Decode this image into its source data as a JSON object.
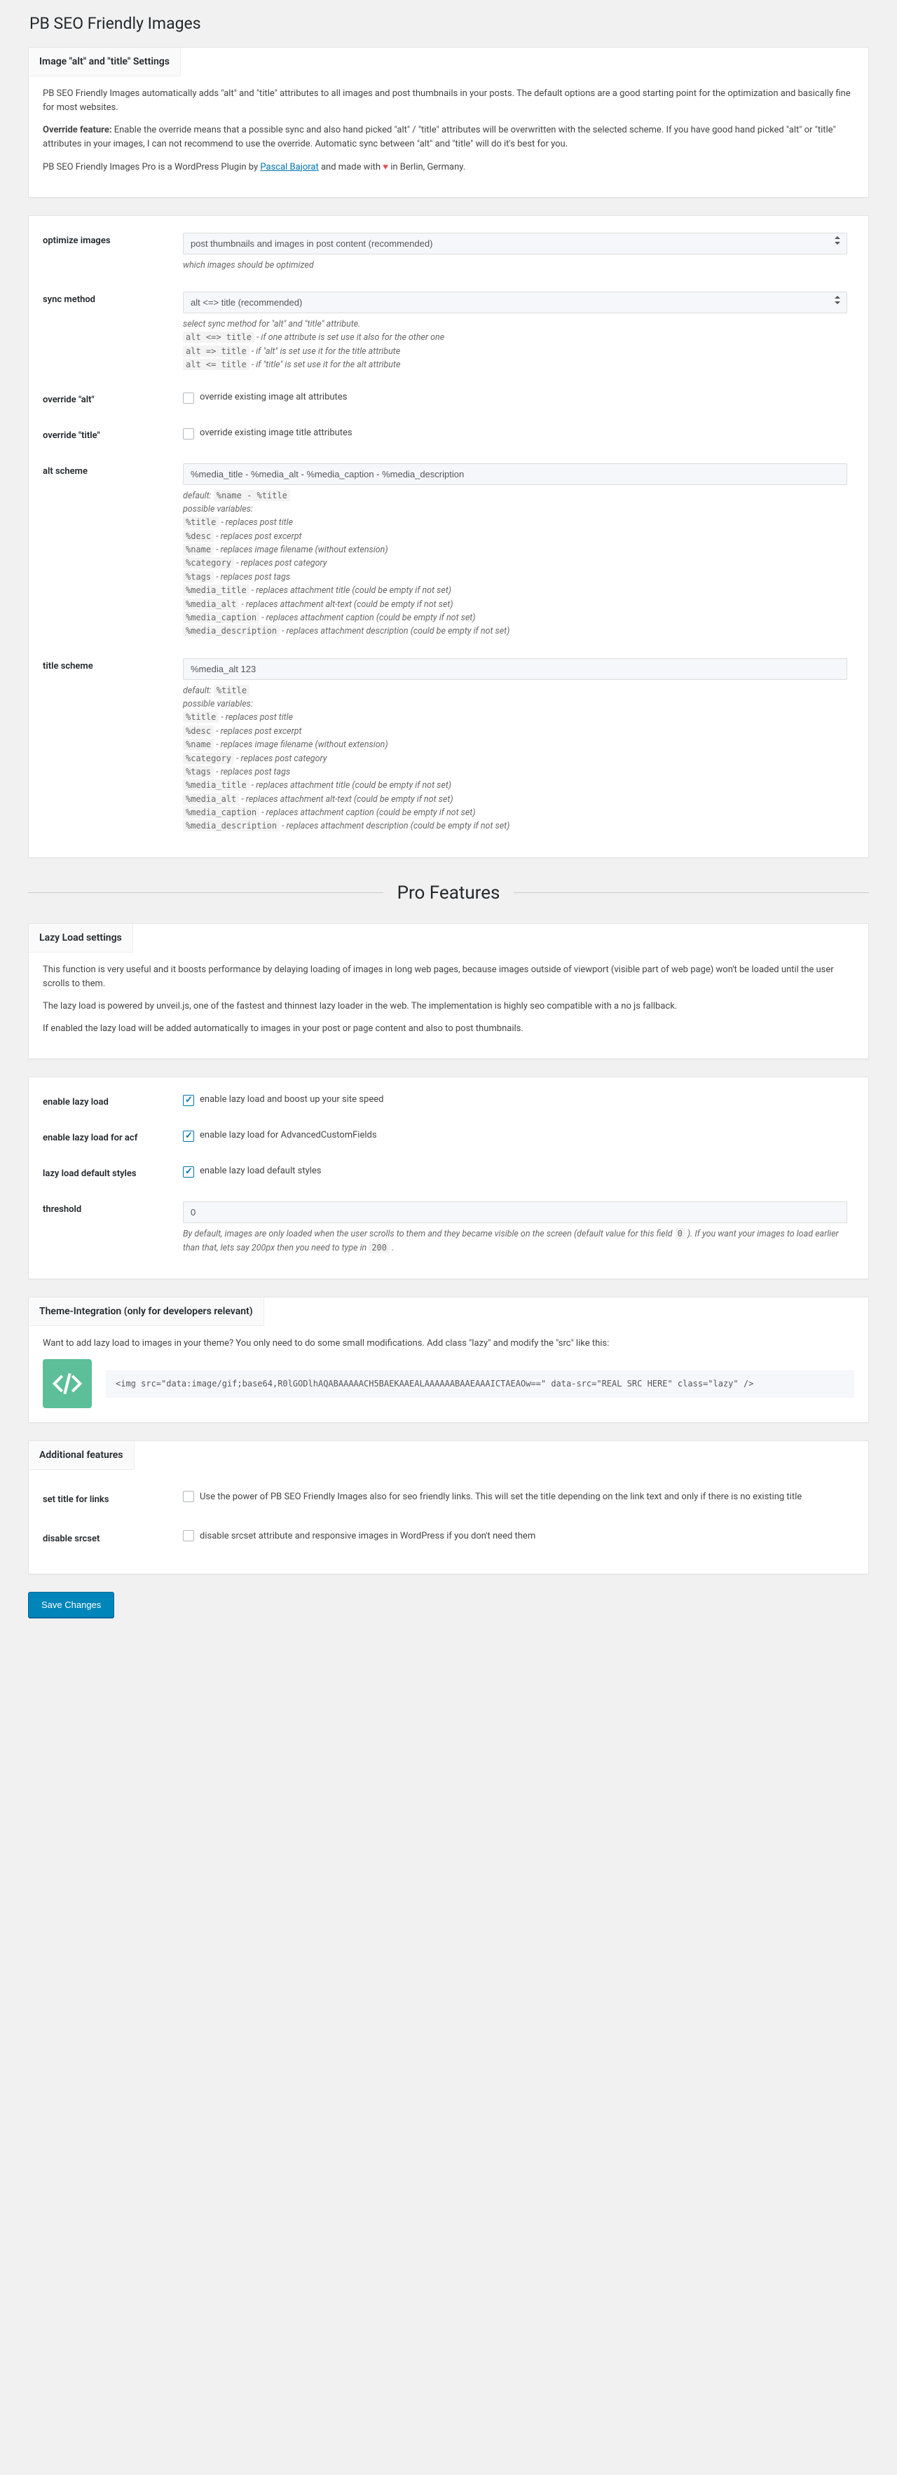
{
  "page_title": "PB SEO Friendly Images",
  "box1": {
    "title": "Image \"alt\" and \"title\" Settings",
    "p1": "PB SEO Friendly Images automatically adds \"alt\" and \"title\" attributes to all images and post thumbnails in your posts. The default options are a good starting point for the optimization and basically fine for most websites.",
    "p2a": "Override feature:",
    "p2b": " Enable the override means that a possible sync and also hand picked \"alt\" / \"title\" attributes will be overwritten with the selected scheme. If you have good hand picked \"alt\" or \"title\" attributes in your images, I can not recommend to use the override. Automatic sync between \"alt\" and \"title\" will do it's best for you.",
    "p3a": "PB SEO Friendly Images Pro is a WordPress Plugin by ",
    "p3_link": "Pascal Bajorat",
    "p3b": " and made with ",
    "p3c": " in Berlin, Germany."
  },
  "form1": {
    "optimize": {
      "label": "optimize images",
      "value": "post thumbnails and images in post content (recommended)",
      "desc": "which images should be optimized"
    },
    "sync": {
      "label": "sync method",
      "value": "alt <=> title (recommended)",
      "desc0": "select sync method for \"alt\" and \"title\" attribute.",
      "c1": "alt <=> title",
      "d1": " - if one attribute is set use it also for the other one",
      "c2": "alt => title",
      "d2": " - if \"alt\" is set use it for the title attribute",
      "c3": "alt <= title",
      "d3": " - if \"title\" is set use it for the alt attribute"
    },
    "ovr_alt": {
      "label": "override \"alt\"",
      "text": "override existing image alt attributes"
    },
    "ovr_title": {
      "label": "override \"title\"",
      "text": "override existing image title attributes"
    },
    "alt_scheme": {
      "label": "alt scheme",
      "value": "%media_title - %media_alt - %media_caption - %media_description",
      "default": "%name - %title"
    },
    "title_scheme": {
      "label": "title scheme",
      "value": "%media_alt 123",
      "default": "%title"
    },
    "vars": {
      "default_label": "default: ",
      "poss": "possible variables:",
      "v1c": "%title",
      "v1d": " - replaces post title",
      "v2c": "%desc",
      "v2d": " - replaces post excerpt",
      "v3c": "%name",
      "v3d": " - replaces image filename (without extension)",
      "v4c": "%category",
      "v4d": " - replaces post category",
      "v5c": "%tags",
      "v5d": " - replaces post tags",
      "v6c": "%media_title",
      "v6d": " - replaces attachment title (could be empty if not set)",
      "v7c": "%media_alt",
      "v7d": " - replaces attachment alt-text (could be empty if not set)",
      "v8c": "%media_caption",
      "v8d": " - replaces attachment caption (could be empty if not set)",
      "v9c": "%media_description",
      "v9d": " - replaces attachment description (could be empty if not set)"
    }
  },
  "pro_title": "Pro Features",
  "box2": {
    "title": "Lazy Load settings",
    "p1": "This function is very useful and it boosts performance by delaying loading of images in long web pages, because images outside of viewport (visible part of web page) won't be loaded until the user scrolls to them.",
    "p2": "The lazy load is powered by unveil.js, one of the fastest and thinnest lazy loader in the web. The implementation is highly seo compatible with a no js fallback.",
    "p3": "If enabled the lazy load will be added automatically to images in your post or page content and also to post thumbnails."
  },
  "form2": {
    "enable": {
      "label": "enable lazy load",
      "text": "enable lazy load and boost up your site speed"
    },
    "acf": {
      "label": "enable lazy load for acf",
      "text": "enable lazy load for AdvancedCustomFields"
    },
    "styles": {
      "label": "lazy load default styles",
      "text": "enable lazy load default styles"
    },
    "thresh": {
      "label": "threshold",
      "value": "0",
      "d1": "By default, images are only loaded when the user scrolls to them and they became visible on the screen (default value for this field ",
      "c1": "0",
      "d2": " ). If you want your images to load earlier than that, lets say 200px then you need to type in ",
      "c2": "200",
      "d3": " ."
    }
  },
  "box3": {
    "title": "Theme-Integration (only for developers relevant)",
    "p1": "Want to add lazy load to images in your theme? You only need to do some small modifications. Add class \"lazy\" and modify the \"src\" like this:",
    "code": "<img src=\"data:image/gif;base64,R0lGODlhAQABAAAAACH5BAEKAAEALAAAAAABAAEAAAICTAEAOw==\" data-src=\"REAL SRC HERE\" class=\"lazy\" />"
  },
  "box4": {
    "title": "Additional features",
    "links": {
      "label": "set title for links",
      "text": "Use the power of PB SEO Friendly Images also for seo friendly links. This will set the title depending on the link text and only if there is no existing title"
    },
    "srcset": {
      "label": "disable srcset",
      "text": "disable srcset attribute and responsive images in WordPress if you don't need them"
    }
  },
  "save": "Save Changes"
}
